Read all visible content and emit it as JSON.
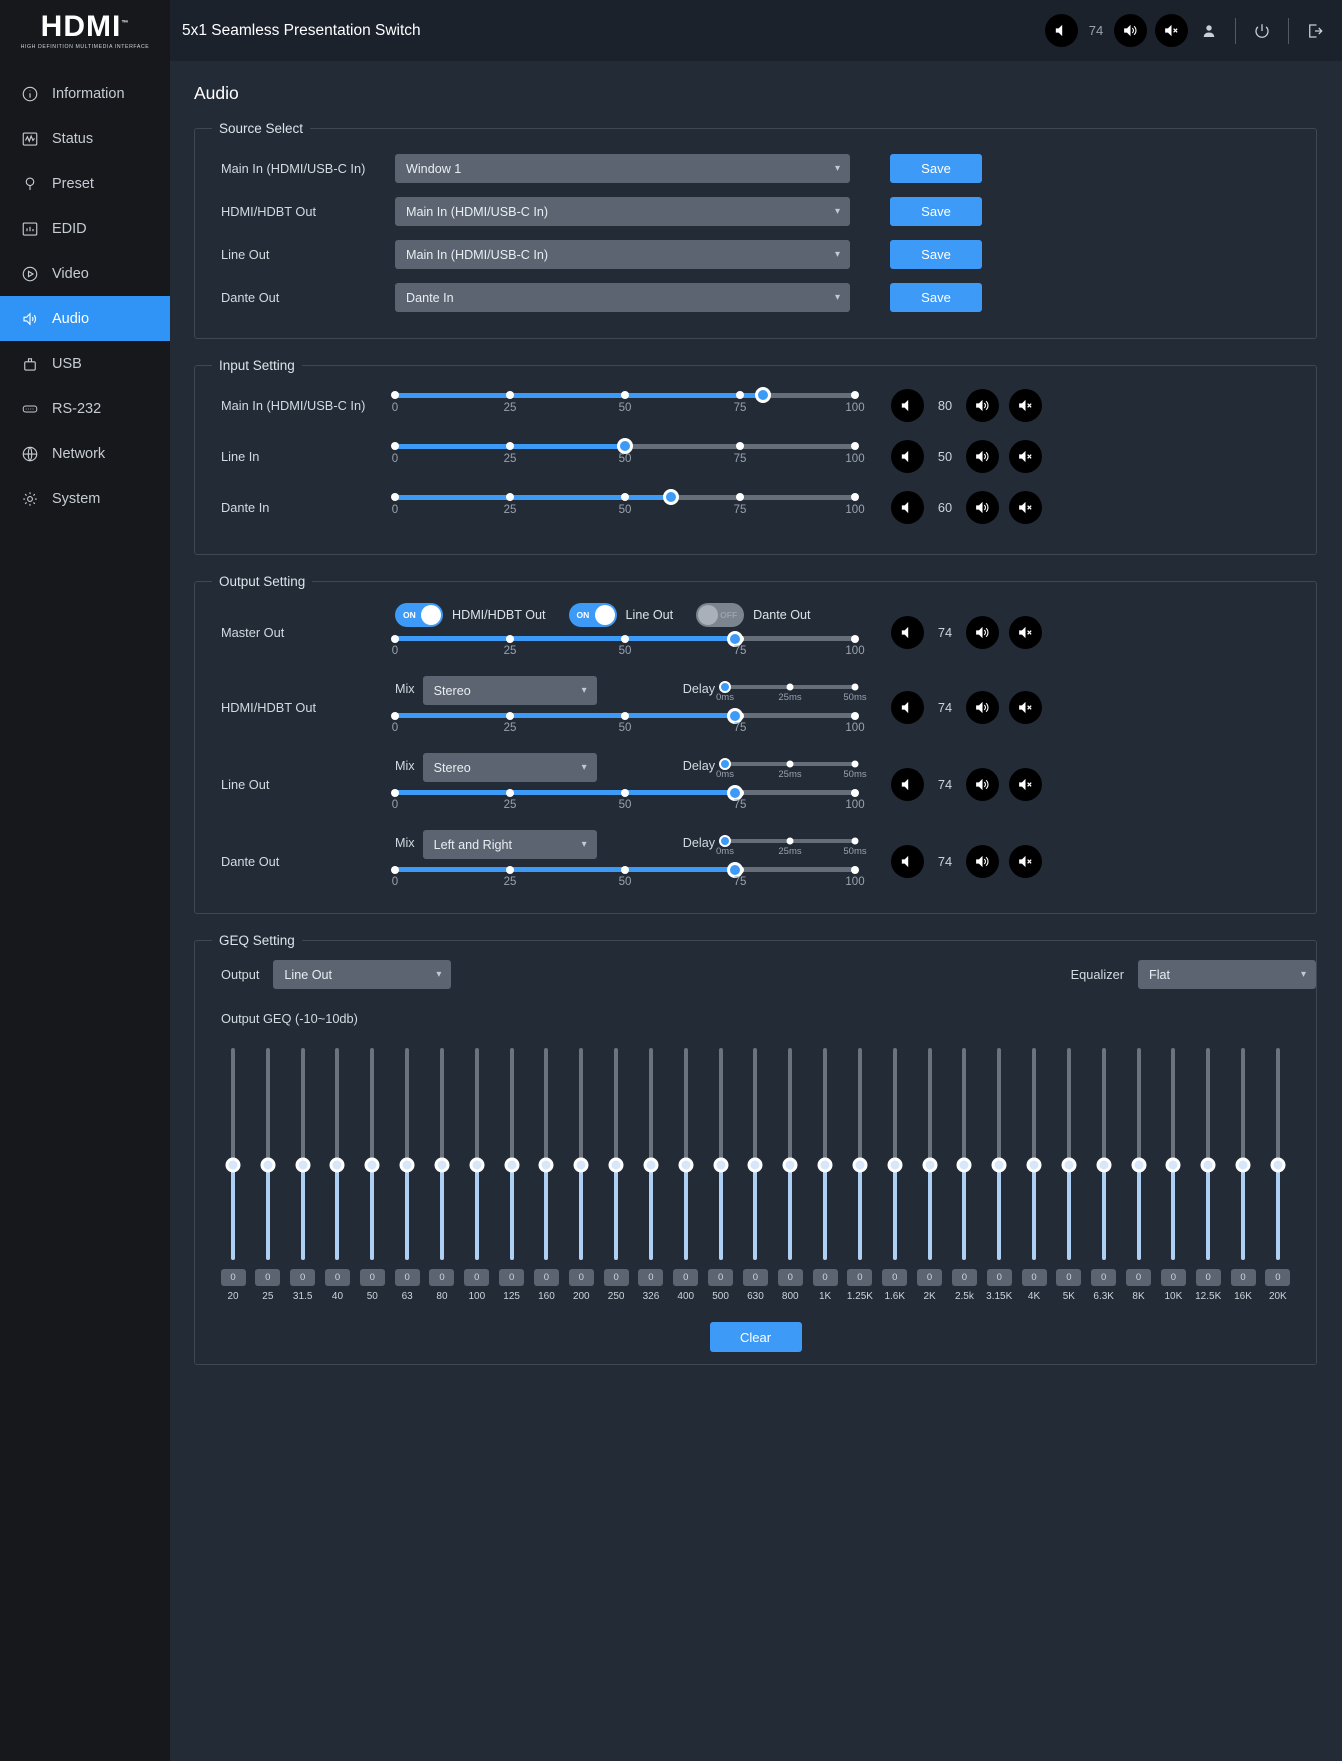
{
  "brand": {
    "logo": "HDMI",
    "logo_tm": "™",
    "logo_sub": "HIGH DEFINITION MULTIMEDIA INTERFACE"
  },
  "header": {
    "title": "5x1 Seamless Presentation Switch",
    "volume_value": "74",
    "icons": [
      "volume-down-icon",
      "volume-up-icon",
      "mute-icon",
      "user-icon",
      "power-icon",
      "logout-icon"
    ]
  },
  "sidebar": {
    "items": [
      {
        "label": "Information",
        "icon": "info-icon",
        "active": false
      },
      {
        "label": "Status",
        "icon": "status-icon",
        "active": false
      },
      {
        "label": "Preset",
        "icon": "preset-icon",
        "active": false
      },
      {
        "label": "EDID",
        "icon": "edid-icon",
        "active": false
      },
      {
        "label": "Video",
        "icon": "video-icon",
        "active": false
      },
      {
        "label": "Audio",
        "icon": "audio-icon",
        "active": true
      },
      {
        "label": "USB",
        "icon": "usb-icon",
        "active": false
      },
      {
        "label": "RS-232",
        "icon": "rs232-icon",
        "active": false
      },
      {
        "label": "Network",
        "icon": "network-icon",
        "active": false
      },
      {
        "label": "System",
        "icon": "system-icon",
        "active": false
      }
    ]
  },
  "page": {
    "title": "Audio"
  },
  "source_select": {
    "legend": "Source Select",
    "save_label": "Save",
    "rows": [
      {
        "label": "Main In (HDMI/USB-C In)",
        "value": "Window 1"
      },
      {
        "label": "HDMI/HDBT Out",
        "value": "Main In (HDMI/USB-C In)"
      },
      {
        "label": "Line Out",
        "value": "Main In (HDMI/USB-C In)"
      },
      {
        "label": "Dante Out",
        "value": "Dante In"
      }
    ]
  },
  "input_setting": {
    "legend": "Input Setting",
    "scale": [
      "0",
      "25",
      "50",
      "75",
      "100"
    ],
    "rows": [
      {
        "label": "Main In (HDMI/USB-C In)",
        "value": "80"
      },
      {
        "label": "Line In",
        "value": "50"
      },
      {
        "label": "Dante In",
        "value": "60"
      }
    ]
  },
  "output_setting": {
    "legend": "Output Setting",
    "scale": [
      "0",
      "25",
      "50",
      "75",
      "100"
    ],
    "delay_scale": [
      "0ms",
      "25ms",
      "50ms"
    ],
    "mix_label": "Mix",
    "delay_label": "Delay",
    "master": {
      "label": "Master Out",
      "value": "74",
      "toggles": [
        {
          "label": "HDMI/HDBT Out",
          "state": "ON"
        },
        {
          "label": "Line Out",
          "state": "ON"
        },
        {
          "label": "Dante Out",
          "state": "OFF"
        }
      ]
    },
    "rows": [
      {
        "label": "HDMI/HDBT Out",
        "mix": "Stereo",
        "delay": "0ms",
        "value": "74"
      },
      {
        "label": "Line Out",
        "mix": "Stereo",
        "delay": "0ms",
        "value": "74"
      },
      {
        "label": "Dante Out",
        "mix": "Left and Right",
        "delay": "0ms",
        "value": "74"
      }
    ]
  },
  "geq_setting": {
    "legend": "GEQ Setting",
    "output_label": "Output",
    "output_value": "Line Out",
    "equalizer_label": "Equalizer",
    "equalizer_value": "Flat",
    "subtitle": "Output GEQ (-10~10db)",
    "clear_label": "Clear",
    "bands": [
      {
        "freq": "20",
        "value": "0"
      },
      {
        "freq": "25",
        "value": "0"
      },
      {
        "freq": "31.5",
        "value": "0"
      },
      {
        "freq": "40",
        "value": "0"
      },
      {
        "freq": "50",
        "value": "0"
      },
      {
        "freq": "63",
        "value": "0"
      },
      {
        "freq": "80",
        "value": "0"
      },
      {
        "freq": "100",
        "value": "0"
      },
      {
        "freq": "125",
        "value": "0"
      },
      {
        "freq": "160",
        "value": "0"
      },
      {
        "freq": "200",
        "value": "0"
      },
      {
        "freq": "250",
        "value": "0"
      },
      {
        "freq": "326",
        "value": "0"
      },
      {
        "freq": "400",
        "value": "0"
      },
      {
        "freq": "500",
        "value": "0"
      },
      {
        "freq": "630",
        "value": "0"
      },
      {
        "freq": "800",
        "value": "0"
      },
      {
        "freq": "1K",
        "value": "0"
      },
      {
        "freq": "1.25K",
        "value": "0"
      },
      {
        "freq": "1.6K",
        "value": "0"
      },
      {
        "freq": "2K",
        "value": "0"
      },
      {
        "freq": "2.5k",
        "value": "0"
      },
      {
        "freq": "3.15K",
        "value": "0"
      },
      {
        "freq": "4K",
        "value": "0"
      },
      {
        "freq": "5K",
        "value": "0"
      },
      {
        "freq": "6.3K",
        "value": "0"
      },
      {
        "freq": "8K",
        "value": "0"
      },
      {
        "freq": "10K",
        "value": "0"
      },
      {
        "freq": "12.5K",
        "value": "0"
      },
      {
        "freq": "16K",
        "value": "0"
      },
      {
        "freq": "20K",
        "value": "0"
      }
    ]
  },
  "colors": {
    "accent": "#3d9bf7",
    "sidebar_bg": "#16181c",
    "panel_bg": "#222b36",
    "select_bg": "#5b6470"
  }
}
